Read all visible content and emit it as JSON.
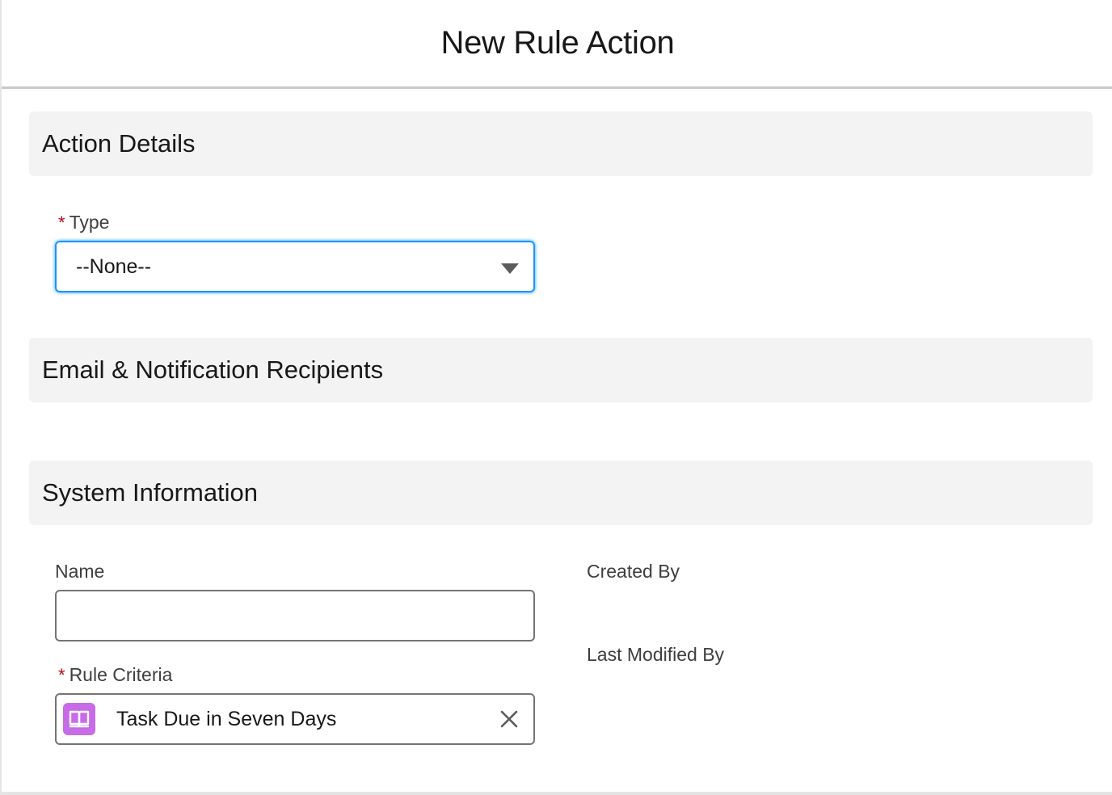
{
  "modal": {
    "title": "New Rule Action"
  },
  "sections": {
    "action_details": "Action Details",
    "recipients": "Email & Notification Recipients",
    "system_info": "System Information"
  },
  "fields": {
    "type": {
      "label": "Type",
      "required_mark": "*",
      "selected_value": "--None--"
    },
    "name": {
      "label": "Name",
      "value": ""
    },
    "rule_criteria": {
      "label": "Rule Criteria",
      "required_mark": "*",
      "selected_value": "Task Due in Seven Days"
    },
    "created_by": {
      "label": "Created By"
    },
    "last_modified_by": {
      "label": "Last Modified By"
    }
  },
  "icons": {
    "select_caret": "chevron-down-icon",
    "rule_criteria_record": "book-icon",
    "clear": "close-icon"
  },
  "colors": {
    "focus_blue": "#1b96ff",
    "required_red": "#ba0517",
    "section_bg": "#f3f3f3",
    "record_icon_purple": "#c86be6"
  }
}
